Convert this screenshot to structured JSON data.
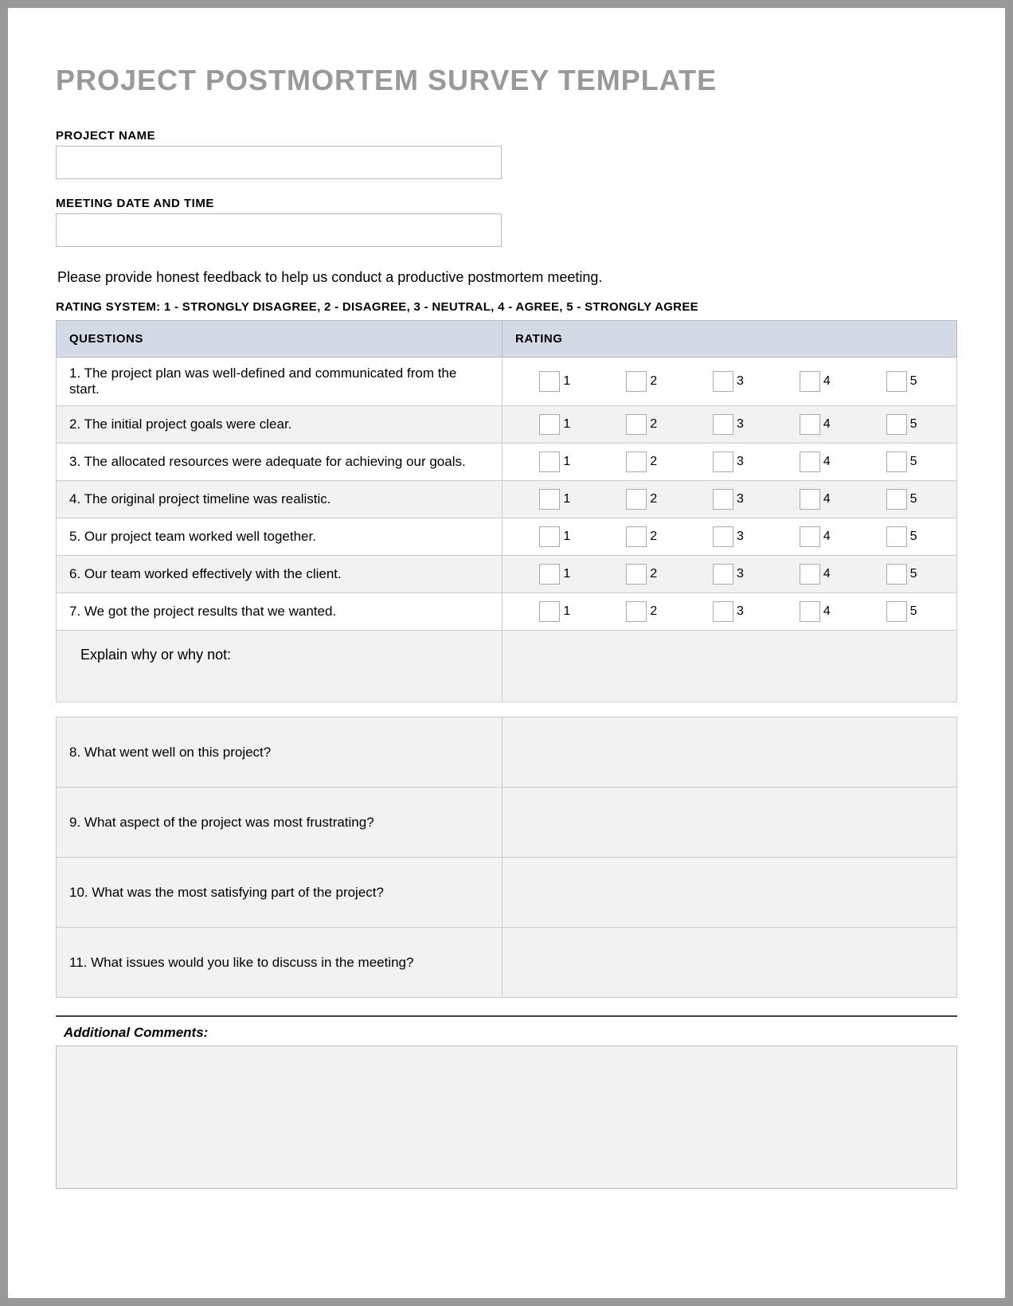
{
  "title": "PROJECT POSTMORTEM SURVEY TEMPLATE",
  "project_name_label": "PROJECT NAME",
  "project_name_value": "",
  "meeting_label": "MEETING DATE AND TIME",
  "meeting_value": "",
  "instructions": "Please provide honest feedback to help us conduct a productive postmortem meeting.",
  "rating_system": "RATING SYSTEM: 1 - STRONGLY DISAGREE, 2 - DISAGREE, 3 - NEUTRAL, 4 - AGREE, 5 - STRONGLY AGREE",
  "col_questions": "QUESTIONS",
  "col_rating": "RATING",
  "ratings": [
    "1",
    "2",
    "3",
    "4",
    "5"
  ],
  "rqs": [
    "1. The project plan was well-defined and communicated from the start.",
    "2. The initial project goals were clear.",
    "3. The allocated resources were adequate for achieving our goals.",
    "4. The original project timeline was realistic.",
    "5. Our project team worked well together.",
    "6. Our team worked effectively with the client.",
    "7. We got the project results that we wanted."
  ],
  "explain": "Explain why or why not:",
  "oqs": [
    "8. What went well on this project?",
    "9. What aspect of the project was most frustrating?",
    "10. What was the most satisfying part of the project?",
    "11. What issues would you like to discuss in the meeting?"
  ],
  "comments_label": "Additional Comments:"
}
